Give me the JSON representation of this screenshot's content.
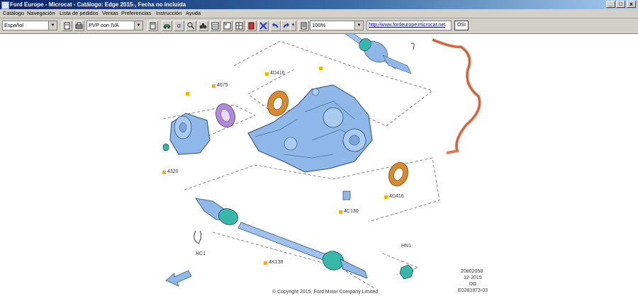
{
  "window": {
    "title": "Ford Europe - Microcat - Catálogo: Edge 2015-, Fecha no incluida",
    "minimize_glyph": "_",
    "maximize_glyph": "□",
    "close_glyph": "x"
  },
  "menu": {
    "items": [
      {
        "label": "Catálogo"
      },
      {
        "label": "Navegación"
      },
      {
        "label": "Lista de pedidos"
      },
      {
        "label": "Ventas"
      },
      {
        "label": "Preferencias"
      },
      {
        "label": "Instrucción"
      },
      {
        "label": "Ayuda"
      }
    ]
  },
  "toolbar": {
    "language": "Español",
    "price_mode": "PVP con IVA",
    "zoom": "100%",
    "url": "http://www.fordeurope.microcat.net",
    "osi_label": "OSI",
    "alpha_glyph": "α",
    "dropdown_glyph": "▼"
  },
  "diagram": {
    "part_labels": {
      "p4D416_top": "4D416",
      "p4675": "4675",
      "p4320": "4320",
      "p4D416_bottom": "4D416",
      "p4C130": "4C130",
      "pHC1": "HC1",
      "pHN1": "HN1",
      "p4K138": "4K138"
    },
    "info": {
      "code": "20802058",
      "date": "12-2015",
      "region": "DG",
      "ref": "E0281873-03",
      "copyright": "© Copyright 2015, Ford Motor Company Limited"
    },
    "colors": {
      "part_blue": "#8fb8e8",
      "seal_orange": "#d98a2e",
      "seal_purple": "#b08ad8",
      "boot_teal": "#38b8a8",
      "harness_orange": "#e07a50",
      "marker_yellow": "#f2b400"
    }
  }
}
